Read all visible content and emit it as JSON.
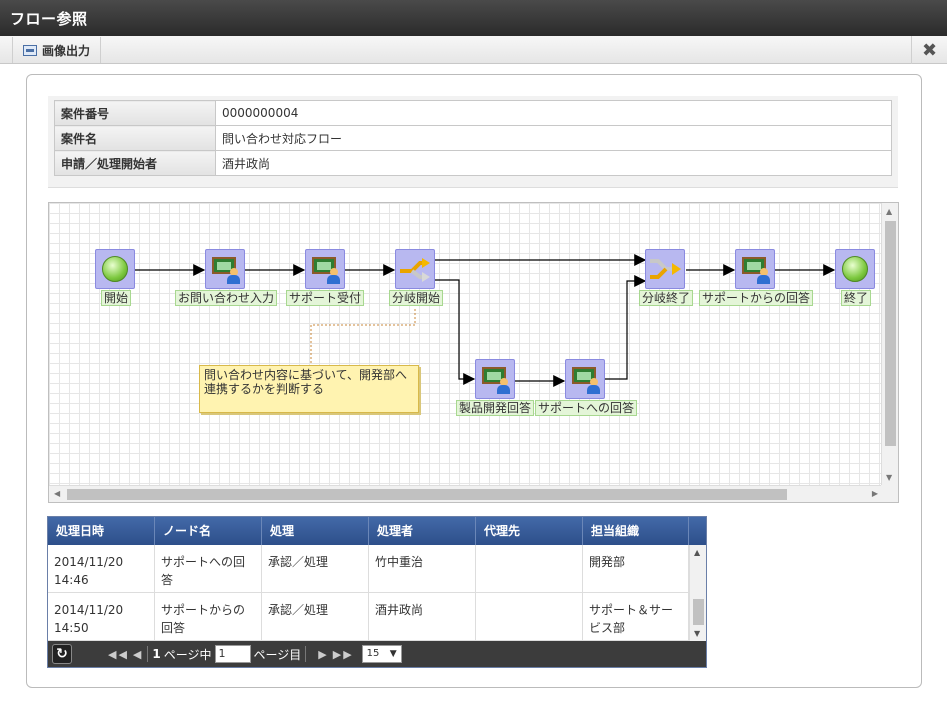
{
  "window": {
    "title": "フロー参照"
  },
  "toolbar": {
    "export_label": "画像出力",
    "close_glyph": "✖"
  },
  "info": {
    "rows": [
      {
        "key": "案件番号",
        "value": "0000000004"
      },
      {
        "key": "案件名",
        "value": "問い合わせ対応フロー"
      },
      {
        "key": "申請／処理開始者",
        "value": "酒井政尚"
      }
    ]
  },
  "flow": {
    "nodes": {
      "start": "開始",
      "inquiry": "お問い合わせ入力",
      "support_accept": "サポート受付",
      "branch_start": "分岐開始",
      "dev_answer": "製品開発回答",
      "support_answer_to": "サポートへの回答",
      "branch_end": "分岐終了",
      "support_answer_from": "サポートからの回答",
      "end": "終了"
    },
    "note": "問い合わせ内容に基づいて、開発部へ連携するかを判断する"
  },
  "history": {
    "columns": [
      "処理日時",
      "ノード名",
      "処理",
      "処理者",
      "代理先",
      "担当組織"
    ],
    "rows": [
      {
        "datetime": "2014/11/20 14:46",
        "node": "サポートへの回答",
        "action": "承認／処理",
        "user": "竹中重治",
        "proxy": "",
        "org": "開発部"
      },
      {
        "datetime": "2014/11/20 14:50",
        "node": "サポートからの回答",
        "action": "承認／処理",
        "user": "酒井政尚",
        "proxy": "",
        "org": "サポート＆サービス部"
      }
    ],
    "pager": {
      "current_page": "1",
      "page_text_mid": "ページ中",
      "page_input": "1",
      "page_text_end": "ページ目",
      "page_size": "15"
    }
  }
}
